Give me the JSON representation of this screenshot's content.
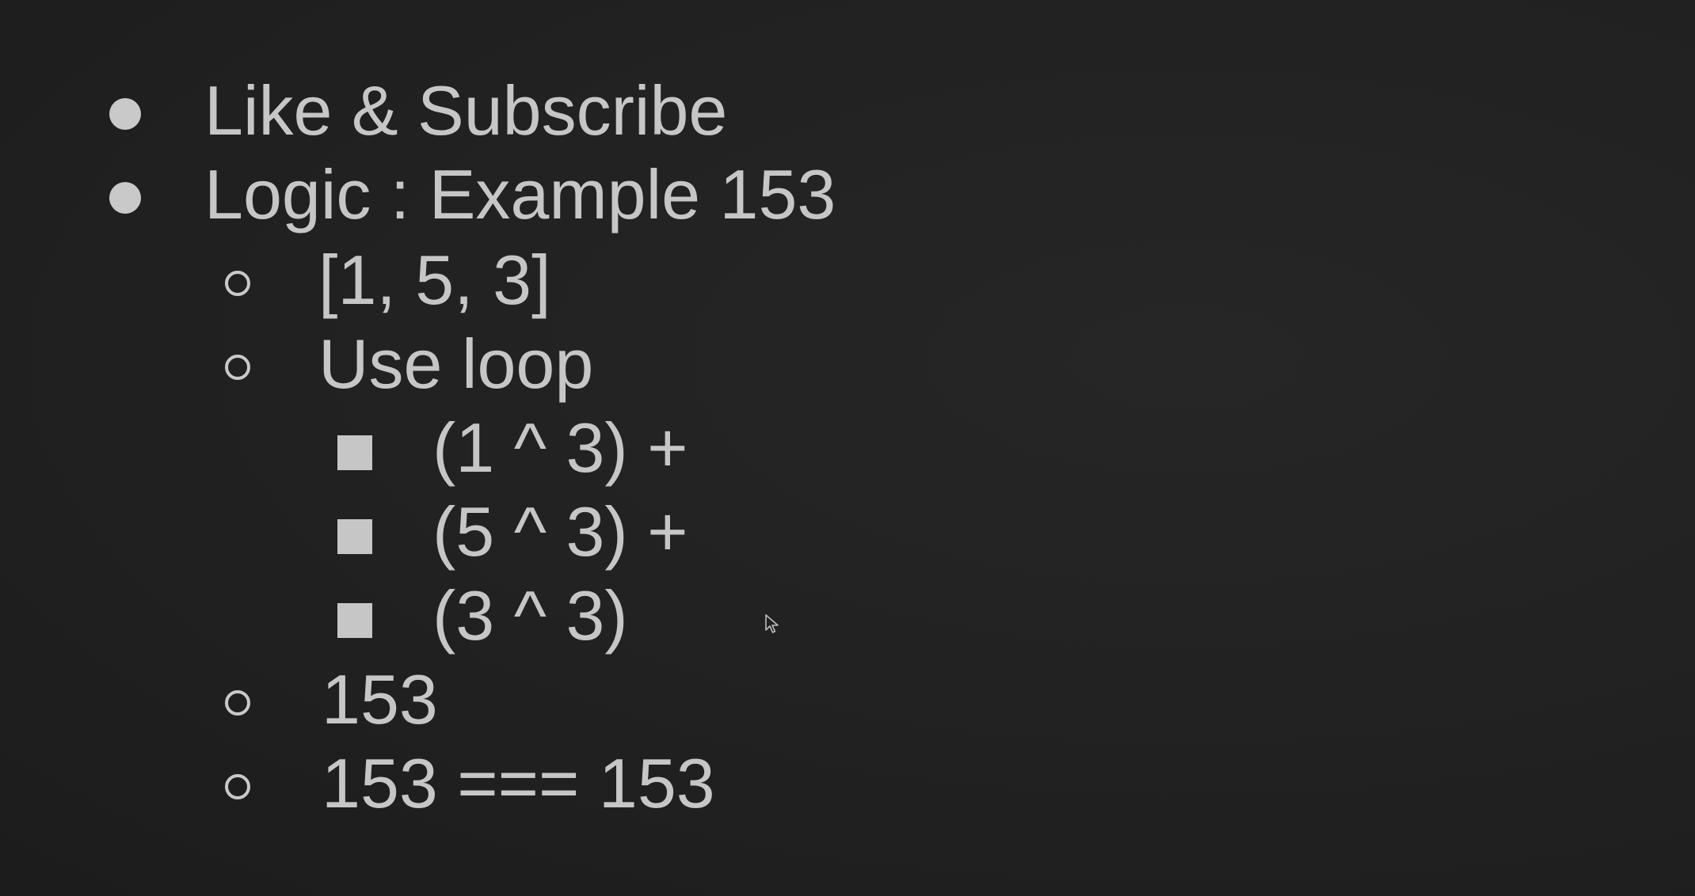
{
  "slide": {
    "items": [
      {
        "level": 1,
        "text": "Like & Subscribe",
        "bullet": "disc-bullet-icon"
      },
      {
        "level": 1,
        "text": "Logic : Example 153",
        "bullet": "disc-bullet-icon"
      },
      {
        "level": 2,
        "text": "[1, 5, 3]",
        "bullet": "circle-bullet-icon"
      },
      {
        "level": 2,
        "text": "Use loop",
        "bullet": "circle-bullet-icon"
      },
      {
        "level": 3,
        "text": "(1 ^ 3) +",
        "bullet": "square-bullet-icon"
      },
      {
        "level": 3,
        "text": "(5 ^ 3) +",
        "bullet": "square-bullet-icon"
      },
      {
        "level": 3,
        "text": "(3 ^ 3)",
        "bullet": "square-bullet-icon"
      },
      {
        "level": 2,
        "text": "153",
        "bullet": "circle-bullet-icon"
      },
      {
        "level": 2,
        "text": "153 === 153",
        "bullet": "circle-bullet-icon"
      }
    ]
  },
  "cursor": {
    "icon": "mouse-pointer-icon"
  },
  "colors": {
    "background": "#222222",
    "text": "#c6c6c6"
  }
}
